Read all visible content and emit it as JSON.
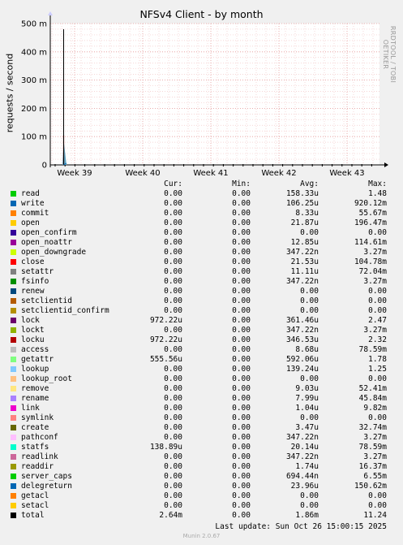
{
  "chart_data": {
    "type": "line",
    "title": "NFSv4 Client - by month",
    "ylabel": "requests / second",
    "ylim": [
      0,
      500
    ],
    "y_ticks": [
      "0",
      "100 m",
      "200 m",
      "300 m",
      "400 m",
      "500 m"
    ],
    "x_ticks": [
      "Week 39",
      "Week 40",
      "Week 41",
      "Week 42",
      "Week 43"
    ],
    "spike": {
      "at": "Week 39",
      "peak": 480,
      "stacked_low": 105
    },
    "columns": [
      "Cur:",
      "Min:",
      "Avg:",
      "Max:"
    ],
    "series": [
      {
        "name": "read",
        "color": "#00cc00",
        "cur": "0.00",
        "min": "0.00",
        "avg": "158.33u",
        "max": "1.48"
      },
      {
        "name": "write",
        "color": "#0066b3",
        "cur": "0.00",
        "min": "0.00",
        "avg": "106.25u",
        "max": "920.12m"
      },
      {
        "name": "commit",
        "color": "#ff8000",
        "cur": "0.00",
        "min": "0.00",
        "avg": "8.33u",
        "max": "55.67m"
      },
      {
        "name": "open",
        "color": "#ffcc00",
        "cur": "0.00",
        "min": "0.00",
        "avg": "21.87u",
        "max": "196.47m"
      },
      {
        "name": "open_confirm",
        "color": "#330099",
        "cur": "0.00",
        "min": "0.00",
        "avg": "0.00",
        "max": "0.00"
      },
      {
        "name": "open_noattr",
        "color": "#990099",
        "cur": "0.00",
        "min": "0.00",
        "avg": "12.85u",
        "max": "114.61m"
      },
      {
        "name": "open_downgrade",
        "color": "#ccff00",
        "cur": "0.00",
        "min": "0.00",
        "avg": "347.22n",
        "max": "3.27m"
      },
      {
        "name": "close",
        "color": "#ff0000",
        "cur": "0.00",
        "min": "0.00",
        "avg": "21.53u",
        "max": "104.78m"
      },
      {
        "name": "setattr",
        "color": "#808080",
        "cur": "0.00",
        "min": "0.00",
        "avg": "11.11u",
        "max": "72.04m"
      },
      {
        "name": "fsinfo",
        "color": "#008f00",
        "cur": "0.00",
        "min": "0.00",
        "avg": "347.22n",
        "max": "3.27m"
      },
      {
        "name": "renew",
        "color": "#00487d",
        "cur": "0.00",
        "min": "0.00",
        "avg": "0.00",
        "max": "0.00"
      },
      {
        "name": "setclientid",
        "color": "#b35a00",
        "cur": "0.00",
        "min": "0.00",
        "avg": "0.00",
        "max": "0.00"
      },
      {
        "name": "setclientid_confirm",
        "color": "#b38f00",
        "cur": "0.00",
        "min": "0.00",
        "avg": "0.00",
        "max": "0.00"
      },
      {
        "name": "lock",
        "color": "#6b006b",
        "cur": "972.22u",
        "min": "0.00",
        "avg": "361.46u",
        "max": "2.47"
      },
      {
        "name": "lockt",
        "color": "#8fb300",
        "cur": "0.00",
        "min": "0.00",
        "avg": "347.22n",
        "max": "3.27m"
      },
      {
        "name": "locku",
        "color": "#b30000",
        "cur": "972.22u",
        "min": "0.00",
        "avg": "346.53u",
        "max": "2.32"
      },
      {
        "name": "access",
        "color": "#bebebe",
        "cur": "0.00",
        "min": "0.00",
        "avg": "8.68u",
        "max": "78.59m"
      },
      {
        "name": "getattr",
        "color": "#80ff80",
        "cur": "555.56u",
        "min": "0.00",
        "avg": "592.06u",
        "max": "1.78"
      },
      {
        "name": "lookup",
        "color": "#80c9ff",
        "cur": "0.00",
        "min": "0.00",
        "avg": "139.24u",
        "max": "1.25"
      },
      {
        "name": "lookup_root",
        "color": "#ffc080",
        "cur": "0.00",
        "min": "0.00",
        "avg": "0.00",
        "max": "0.00"
      },
      {
        "name": "remove",
        "color": "#ffe680",
        "cur": "0.00",
        "min": "0.00",
        "avg": "9.03u",
        "max": "52.41m"
      },
      {
        "name": "rename",
        "color": "#aa80ff",
        "cur": "0.00",
        "min": "0.00",
        "avg": "7.99u",
        "max": "45.84m"
      },
      {
        "name": "link",
        "color": "#ee00cc",
        "cur": "0.00",
        "min": "0.00",
        "avg": "1.04u",
        "max": "9.82m"
      },
      {
        "name": "symlink",
        "color": "#ff8080",
        "cur": "0.00",
        "min": "0.00",
        "avg": "0.00",
        "max": "0.00"
      },
      {
        "name": "create",
        "color": "#666600",
        "cur": "0.00",
        "min": "0.00",
        "avg": "3.47u",
        "max": "32.74m"
      },
      {
        "name": "pathconf",
        "color": "#ffbfff",
        "cur": "0.00",
        "min": "0.00",
        "avg": "347.22n",
        "max": "3.27m"
      },
      {
        "name": "statfs",
        "color": "#00ffcc",
        "cur": "138.89u",
        "min": "0.00",
        "avg": "20.14u",
        "max": "78.59m"
      },
      {
        "name": "readlink",
        "color": "#cc6699",
        "cur": "0.00",
        "min": "0.00",
        "avg": "347.22n",
        "max": "3.27m"
      },
      {
        "name": "readdir",
        "color": "#999900",
        "cur": "0.00",
        "min": "0.00",
        "avg": "1.74u",
        "max": "16.37m"
      },
      {
        "name": "server_caps",
        "color": "#00cc00",
        "cur": "0.00",
        "min": "0.00",
        "avg": "694.44n",
        "max": "6.55m"
      },
      {
        "name": "delegreturn",
        "color": "#0066b3",
        "cur": "0.00",
        "min": "0.00",
        "avg": "23.96u",
        "max": "150.62m"
      },
      {
        "name": "getacl",
        "color": "#ff8000",
        "cur": "0.00",
        "min": "0.00",
        "avg": "0.00",
        "max": "0.00"
      },
      {
        "name": "setacl",
        "color": "#ffcc00",
        "cur": "0.00",
        "min": "0.00",
        "avg": "0.00",
        "max": "0.00"
      },
      {
        "name": "total",
        "color": "#000000",
        "cur": "2.64m",
        "min": "0.00",
        "avg": "1.86m",
        "max": "11.24"
      }
    ]
  },
  "side_label": "RRDTOOL / TOBI OETIKER",
  "last_update": "Last update:  Sun Oct 26 15:00:15 2025",
  "footer": "Munin 2.0.67"
}
